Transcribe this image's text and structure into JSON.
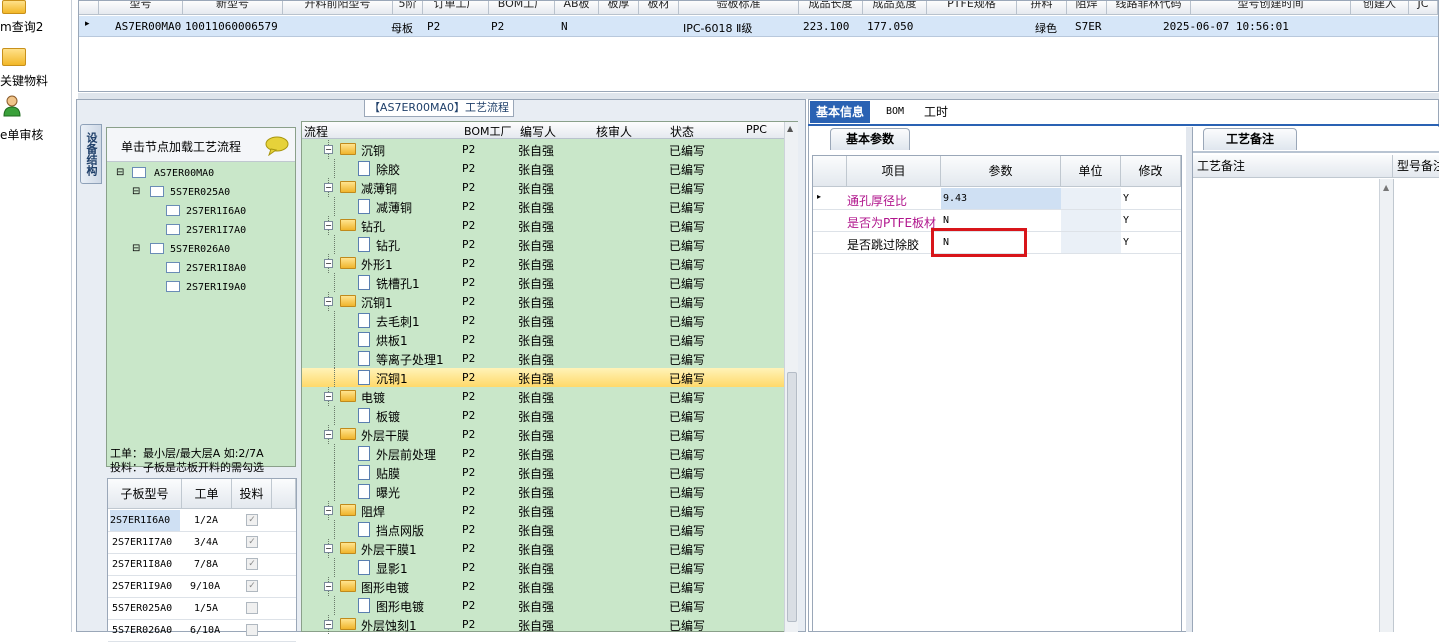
{
  "sidebar": {
    "items": [
      {
        "label": "m查询2",
        "icon": "folder-icon"
      },
      {
        "label": "关键物料",
        "icon": "folder-icon"
      },
      {
        "label": "e单审核",
        "icon": "user-icon"
      }
    ]
  },
  "top_grid": {
    "headers": [
      "型号",
      "新型号",
      "开料前阳型号",
      "5阶",
      "订单工厂",
      "BOM工厂",
      "AB板",
      "板厚",
      "板材",
      "验板标准",
      "成品长度",
      "成品宽度",
      "PTFE规格",
      "拼料",
      "阻焊",
      "线路菲林代码",
      "型号创建时间",
      "创建人",
      "JC"
    ],
    "row": {
      "model": "AS7ER00MA0",
      "new_model": "10011060006579",
      "type": "母板",
      "order_factory": "P2",
      "bom_factory": "P2",
      "ab": "N",
      "standard": "IPC-6018 Ⅱ级",
      "length": "223.100",
      "width": "177.050",
      "solder_color": "绿色",
      "film_code": "S7ER",
      "created": "2025-06-07 10:56:01"
    }
  },
  "left_panel": {
    "vertical_tab": "设备结构",
    "title_tag": "【AS7ER00MA0】工艺流程",
    "tree_header": "单击节点加载工艺流程",
    "tree": [
      {
        "label": "AS7ER00MA0",
        "level": 0,
        "expander": "⊟"
      },
      {
        "label": "5S7ER025A0",
        "level": 1,
        "expander": "⊟"
      },
      {
        "label": "2S7ER1I6A0",
        "level": 2,
        "expander": ""
      },
      {
        "label": "2S7ER1I7A0",
        "level": 2,
        "expander": ""
      },
      {
        "label": "5S7ER026A0",
        "level": 1,
        "expander": "⊟"
      },
      {
        "label": "2S7ER1I8A0",
        "level": 2,
        "expander": ""
      },
      {
        "label": "2S7ER1I9A0",
        "level": 2,
        "expander": ""
      }
    ],
    "note_line1": "工单：最小层/最大层A 如:2/7A",
    "note_line2": "投料：子板是芯板开料的需勾选",
    "sub_grid": {
      "headers": [
        "子板型号",
        "工单",
        "投料"
      ],
      "rows": [
        {
          "model": "2S7ER1I6A0",
          "order": "1/2A",
          "feed": "✓"
        },
        {
          "model": "2S7ER1I7A0",
          "order": "3/4A",
          "feed": "✓"
        },
        {
          "model": "2S7ER1I8A0",
          "order": "7/8A",
          "feed": "✓"
        },
        {
          "model": "2S7ER1I9A0",
          "order": "9/10A",
          "feed": "✓"
        },
        {
          "model": "5S7ER025A0",
          "order": "1/5A",
          "feed": ""
        },
        {
          "model": "5S7ER026A0",
          "order": "6/10A",
          "feed": ""
        }
      ]
    }
  },
  "flow_grid": {
    "headers": [
      "流程",
      "BOM工厂",
      "编写人",
      "核审人",
      "状态",
      "PPC"
    ],
    "rows": [
      {
        "name": "沉铜",
        "level": 0,
        "factory": "P2",
        "author": "张自强",
        "status": "已编写"
      },
      {
        "name": "除胶",
        "level": 1,
        "factory": "P2",
        "author": "张自强",
        "status": "已编写"
      },
      {
        "name": "减薄铜",
        "level": 0,
        "factory": "P2",
        "author": "张自强",
        "status": "已编写"
      },
      {
        "name": "减薄铜",
        "level": 1,
        "factory": "P2",
        "author": "张自强",
        "status": "已编写"
      },
      {
        "name": "钻孔",
        "level": 0,
        "factory": "P2",
        "author": "张自强",
        "status": "已编写"
      },
      {
        "name": "钻孔",
        "level": 1,
        "factory": "P2",
        "author": "张自强",
        "status": "已编写"
      },
      {
        "name": "外形1",
        "level": 0,
        "factory": "P2",
        "author": "张自强",
        "status": "已编写"
      },
      {
        "name": "铣槽孔1",
        "level": 1,
        "factory": "P2",
        "author": "张自强",
        "status": "已编写"
      },
      {
        "name": "沉铜1",
        "level": 0,
        "factory": "P2",
        "author": "张自强",
        "status": "已编写"
      },
      {
        "name": "去毛刺1",
        "level": 1,
        "factory": "P2",
        "author": "张自强",
        "status": "已编写"
      },
      {
        "name": "烘板1",
        "level": 1,
        "factory": "P2",
        "author": "张自强",
        "status": "已编写"
      },
      {
        "name": "等离子处理1",
        "level": 1,
        "factory": "P2",
        "author": "张自强",
        "status": "已编写"
      },
      {
        "name": "沉铜1",
        "level": 1,
        "factory": "P2",
        "author": "张自强",
        "status": "已编写",
        "selected": true
      },
      {
        "name": "电镀",
        "level": 0,
        "factory": "P2",
        "author": "张自强",
        "status": "已编写"
      },
      {
        "name": "板镀",
        "level": 1,
        "factory": "P2",
        "author": "张自强",
        "status": "已编写"
      },
      {
        "name": "外层干膜",
        "level": 0,
        "factory": "P2",
        "author": "张自强",
        "status": "已编写"
      },
      {
        "name": "外层前处理",
        "level": 1,
        "factory": "P2",
        "author": "张自强",
        "status": "已编写"
      },
      {
        "name": "贴膜",
        "level": 1,
        "factory": "P2",
        "author": "张自强",
        "status": "已编写"
      },
      {
        "name": "曝光",
        "level": 1,
        "factory": "P2",
        "author": "张自强",
        "status": "已编写"
      },
      {
        "name": "阻焊",
        "level": 0,
        "factory": "P2",
        "author": "张自强",
        "status": "已编写"
      },
      {
        "name": "挡点网版",
        "level": 1,
        "factory": "P2",
        "author": "张自强",
        "status": "已编写"
      },
      {
        "name": "外层干膜1",
        "level": 0,
        "factory": "P2",
        "author": "张自强",
        "status": "已编写"
      },
      {
        "name": "显影1",
        "level": 1,
        "factory": "P2",
        "author": "张自强",
        "status": "已编写"
      },
      {
        "name": "图形电镀",
        "level": 0,
        "factory": "P2",
        "author": "张自强",
        "status": "已编写"
      },
      {
        "name": "图形电镀",
        "level": 1,
        "factory": "P2",
        "author": "张自强",
        "status": "已编写"
      },
      {
        "name": "外层蚀刻1",
        "level": 0,
        "factory": "P2",
        "author": "张自强",
        "status": "已编写"
      }
    ]
  },
  "right_tabs": [
    "基本信息",
    "BOM",
    "工时"
  ],
  "basic_params": {
    "section_title": "基本参数",
    "headers": [
      "项目",
      "参数",
      "单位",
      "修改"
    ],
    "rows": [
      {
        "item": "通孔厚径比",
        "value": "9.43",
        "unit": "",
        "modify": "Y",
        "highlight": true
      },
      {
        "item": "是否为PTFE板材",
        "value": "N",
        "unit": "",
        "modify": "Y",
        "highlight": true
      },
      {
        "item": "是否跳过除胶",
        "value": "N",
        "unit": "",
        "modify": "Y",
        "highlight": false
      }
    ]
  },
  "notes_panel": {
    "section_title": "工艺备注",
    "headers": [
      "工艺备注",
      "型号备注"
    ]
  },
  "colors": {
    "accent": "#2a62b3",
    "tree_bg": "#c9e7c9",
    "selection": "#ffd96a",
    "highlight_text": "#b0148c",
    "red_box": "#d8151a"
  }
}
